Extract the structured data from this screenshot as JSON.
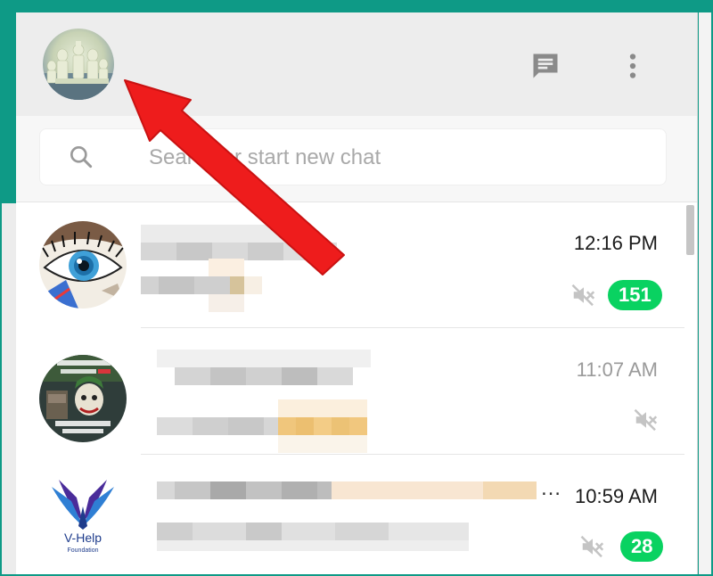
{
  "search": {
    "placeholder": "Search or start new chat"
  },
  "header": {
    "new_chat_icon": "chat-icon",
    "menu_icon": "more-vertical-icon"
  },
  "chats": [
    {
      "time": "12:16 PM",
      "unread": "151",
      "muted": true,
      "time_muted": false
    },
    {
      "time": "11:07 AM",
      "unread": "",
      "muted": true,
      "time_muted": true
    },
    {
      "time": "10:59 AM",
      "unread": "28",
      "muted": true,
      "time_muted": false
    }
  ],
  "vhelp_logo": {
    "name": "V-Help",
    "sub": "Foundation"
  },
  "colors": {
    "teal": "#0e9a86",
    "badge": "#09d261",
    "annotation_arrow": "#ee1c1c"
  }
}
